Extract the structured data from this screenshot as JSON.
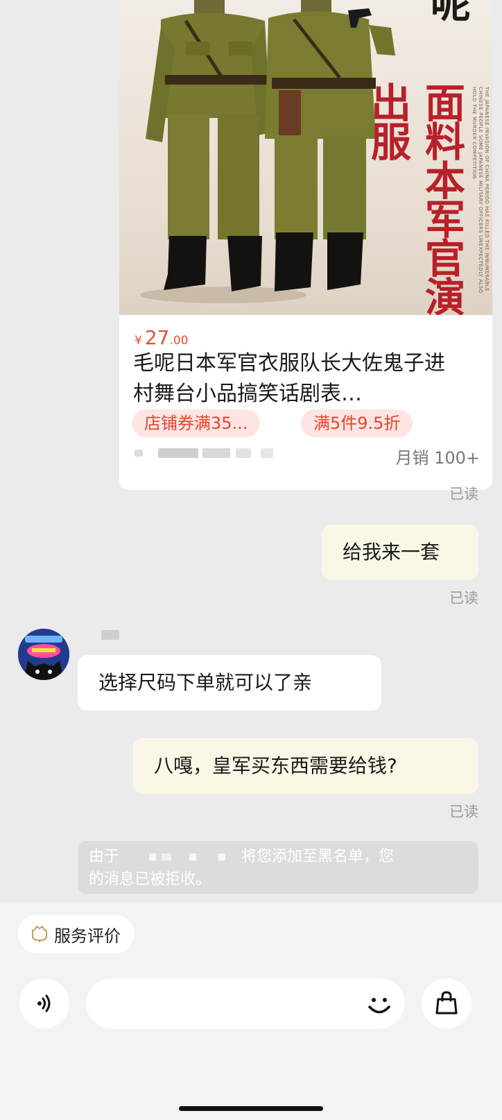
{
  "product_card": {
    "image_text": {
      "top_char": "呢",
      "title_vertical": "面料本军官演出服",
      "fine_print": "THE JAPANESE INVASION OF CHINA PERIOD HAS KILLED THE INNUMERABLE CHINESE PEOPLE SOME JAPANESE MILITARY OFFICERS UNEXPECTEDLY ALSO HOLD THE MURDER COMPETITION"
    },
    "price_symbol": "¥",
    "price_int": "27",
    "price_dec": ".00",
    "title": "毛呢日本军官衣服队长大佐鬼子进村舞台小品搞笑话剧表…",
    "tags": [
      "店铺券满35...",
      "满5件9.5折"
    ],
    "sales": "月销 100+"
  },
  "messages": [
    {
      "side": "me",
      "text": "给我来一套",
      "status": "已读"
    },
    {
      "side": "other",
      "text": "选择尺码下单就可以了亲"
    },
    {
      "side": "me",
      "text": "八嘎，皇军买东西需要给钱?",
      "status": "已读"
    }
  ],
  "card_status": "已读",
  "system_notice": {
    "prefix": "由于",
    "suffix": "将您添加至黑名单，您",
    "line2": "的消息已被拒收。"
  },
  "bottom": {
    "service_chip": "服务评价",
    "voice_icon": "voice-icon",
    "emoji_icon": "smile-icon",
    "bag_icon": "shopping-bag-icon"
  }
}
